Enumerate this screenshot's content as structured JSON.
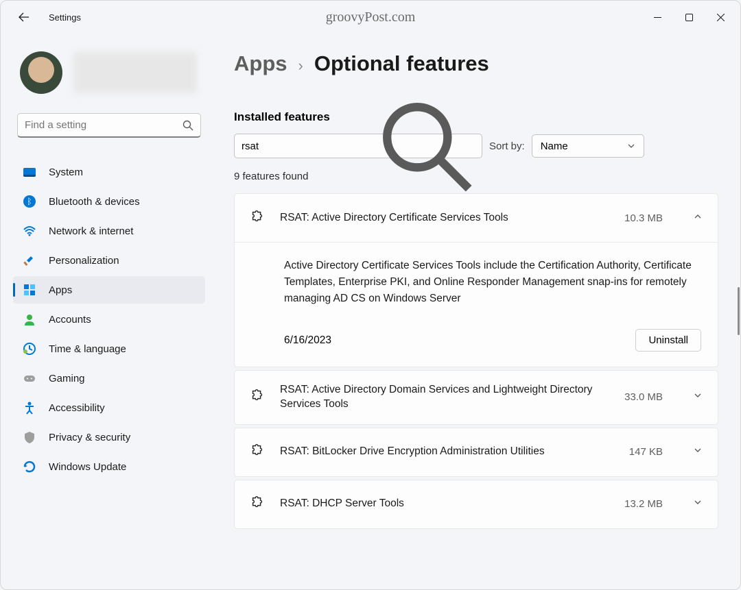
{
  "titlebar": {
    "app_title": "Settings",
    "watermark": "groovyPost.com"
  },
  "sidebar": {
    "search_placeholder": "Find a setting",
    "items": [
      {
        "icon": "system",
        "label": "System"
      },
      {
        "icon": "bluetooth",
        "label": "Bluetooth & devices"
      },
      {
        "icon": "network",
        "label": "Network & internet"
      },
      {
        "icon": "personalize",
        "label": "Personalization"
      },
      {
        "icon": "apps",
        "label": "Apps"
      },
      {
        "icon": "accounts",
        "label": "Accounts"
      },
      {
        "icon": "time",
        "label": "Time & language"
      },
      {
        "icon": "gaming",
        "label": "Gaming"
      },
      {
        "icon": "accessibility",
        "label": "Accessibility"
      },
      {
        "icon": "privacy",
        "label": "Privacy & security"
      },
      {
        "icon": "update",
        "label": "Windows Update"
      }
    ],
    "active_index": 4
  },
  "breadcrumb": {
    "parent": "Apps",
    "current": "Optional features"
  },
  "section": {
    "heading": "Installed features",
    "search_value": "rsat",
    "sort_label": "Sort by:",
    "sort_value": "Name",
    "result_count": "9 features found"
  },
  "features": [
    {
      "name": "RSAT: Active Directory Certificate Services Tools",
      "size": "10.3 MB",
      "expanded": true,
      "description": "Active Directory Certificate Services Tools include the Certification Authority, Certificate Templates, Enterprise PKI, and Online Responder Management snap-ins for remotely managing AD CS on Windows Server",
      "date": "6/16/2023",
      "action_label": "Uninstall"
    },
    {
      "name": "RSAT: Active Directory Domain Services and Lightweight Directory Services Tools",
      "size": "33.0 MB",
      "expanded": false
    },
    {
      "name": "RSAT: BitLocker Drive Encryption Administration Utilities",
      "size": "147 KB",
      "expanded": false
    },
    {
      "name": "RSAT: DHCP Server Tools",
      "size": "13.2 MB",
      "expanded": false
    }
  ]
}
